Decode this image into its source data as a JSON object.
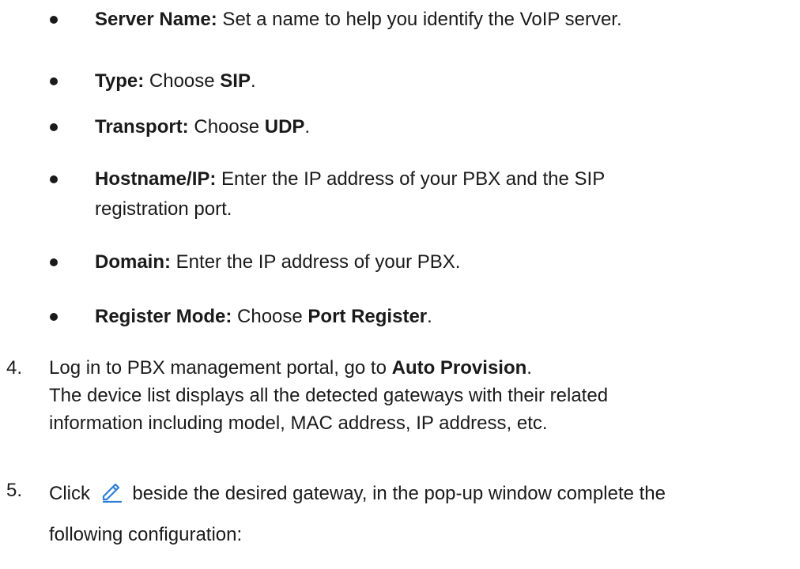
{
  "bullets": [
    {
      "label": "Server Name:",
      "text": " Set a name to help you identify the VoIP server."
    },
    {
      "label": "Type:",
      "text": " Choose ",
      "value": "SIP",
      "end": "."
    },
    {
      "label": "Transport:",
      "text": " Choose ",
      "value": "UDP",
      "end": "."
    },
    {
      "label": "Hostname/IP:",
      "text": " Enter the IP address of your PBX and the SIP",
      "text2": "registration port."
    },
    {
      "label": "Domain:",
      "text": " Enter the IP address of your PBX."
    },
    {
      "label": "Register Mode:",
      "text": " Choose ",
      "value": "Port Register",
      "end": "."
    }
  ],
  "steps": [
    {
      "number": "4.",
      "text": "Log in to PBX management portal, go to ",
      "bold": "Auto Provision",
      "end": ".",
      "line2": "The device list displays all the detected gateways with their related",
      "line3": "information including model, MAC address, IP address, etc."
    },
    {
      "number": "5.",
      "pre": "Click ",
      "icon": "edit-pencil-icon",
      "post": " beside the desired gateway, in the pop-up window complete the",
      "line2": "following configuration:"
    }
  ],
  "colors": {
    "text": "#1a1a1a",
    "icon": "#2b7fd9"
  }
}
